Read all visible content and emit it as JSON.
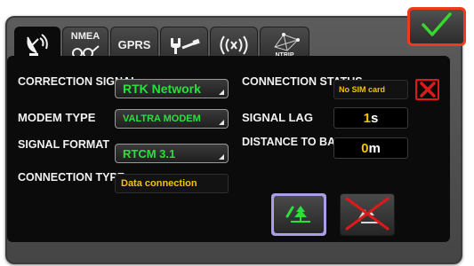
{
  "tabs": [
    {
      "id": "satellite",
      "label": "",
      "icon": "satellite-dish-icon"
    },
    {
      "id": "nmea",
      "label": "NMEA",
      "icon": "glasses-icon"
    },
    {
      "id": "gprs",
      "label": "GPRS",
      "icon": ""
    },
    {
      "id": "tools",
      "label": "",
      "icon": "wrench-screwdriver-icon"
    },
    {
      "id": "radio",
      "label": "",
      "icon": "radio-waves-icon"
    },
    {
      "id": "ntrip",
      "label": "NTRIP",
      "icon": "ntrip-satellite-icon"
    }
  ],
  "left": {
    "correction_signal": {
      "label": "CORRECTION SIGNAL",
      "value": "RTK Network"
    },
    "modem_type": {
      "label": "MODEM TYPE",
      "value": "VALTRA MODEM"
    },
    "signal_format": {
      "label": "SIGNAL FORMAT",
      "value": "RTCM 3.1"
    },
    "connection_type": {
      "label": "CONNECTION TYPE",
      "value": "Data connection"
    }
  },
  "right": {
    "connection_status": {
      "label": "CONNECTION STATUS",
      "value": "No SIM card"
    },
    "signal_lag": {
      "label": "SIGNAL LAG",
      "value": "1",
      "unit": "s"
    },
    "distance_to_base": {
      "label": "DISTANCE TO BASE",
      "value": "0",
      "unit": "m"
    }
  },
  "colors": {
    "accent_green": "#29e03c",
    "value_yellow": "#f2c300",
    "confirm_border": "#ee3b1f",
    "error_red": "#e01818",
    "selected_lavender": "#a89fe6"
  }
}
